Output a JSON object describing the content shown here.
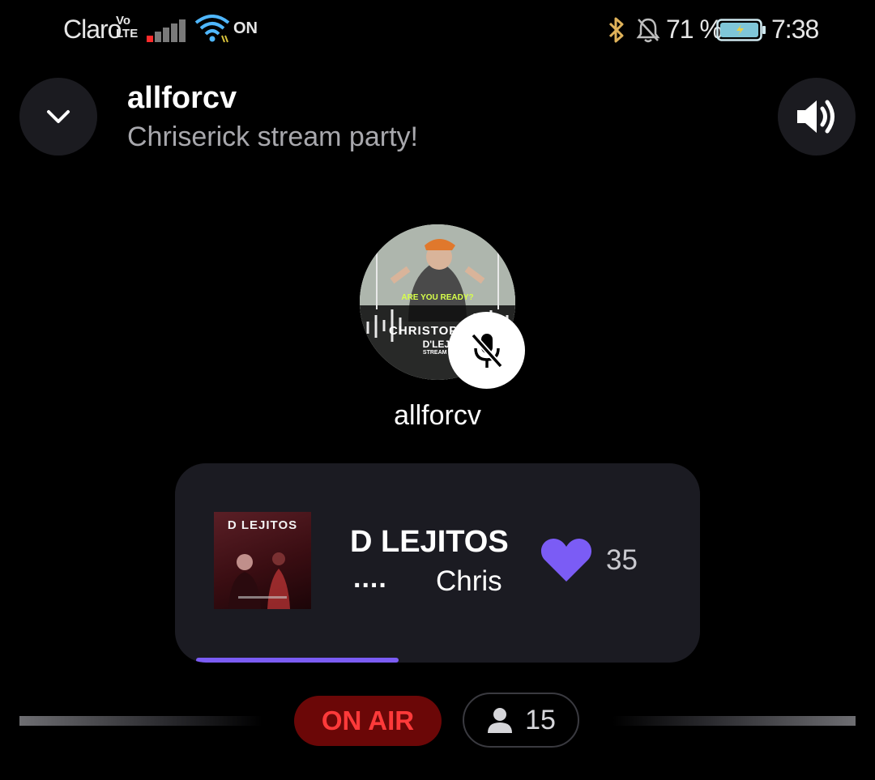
{
  "status_bar": {
    "carrier": "Claro",
    "volte_top": "Vo",
    "volte_bottom": "LTE",
    "data_on": "ON",
    "battery_percent": "71 %",
    "battery_level": 0.71,
    "time": "7:38",
    "icons": [
      "signal-icon",
      "wifi-icon",
      "bluetooth-icon",
      "bell-off-icon",
      "battery-charging-icon"
    ]
  },
  "header": {
    "host_name": "allforcv",
    "room_title": "Chriserick stream party!",
    "collapse_icon": "chevron-down-icon",
    "volume_icon": "volume-icon"
  },
  "speaker": {
    "name": "allforcv",
    "muted": true,
    "avatar_poster_text": [
      "ARE YOU READY?",
      "CHRISTOPHER",
      "D'LEJI",
      "STREAM P"
    ]
  },
  "now_playing": {
    "album_art_text": "D LEJITOS",
    "track_title": "D LEJITOS",
    "track_title_overflow": "....",
    "artist": "Chris",
    "likes": "35",
    "progress": 0.42,
    "colors": {
      "accent": "#7b5cf5"
    }
  },
  "footer": {
    "on_air_label": "ON AIR",
    "listener_count": "15",
    "colors": {
      "on_air_bg": "#6b0707",
      "on_air_text": "#ff3a3a"
    }
  }
}
